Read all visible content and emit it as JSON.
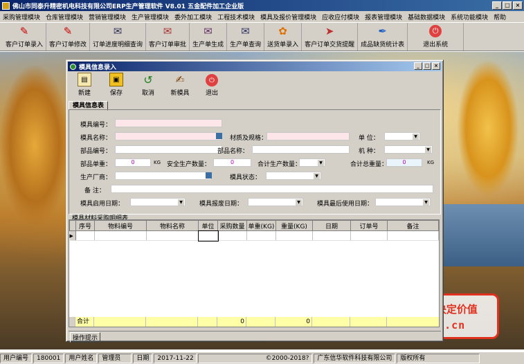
{
  "main_title": "佛山市同泰升精密机电科技有限公司ERP生产管理软件    V8.01  五金配件加工企业版",
  "menu": [
    "采购管理模块",
    "仓库管理模块",
    "营销管理模块",
    "生产管理模块",
    "委外加工模块",
    "工程技术模块",
    "模具及报价管理模块",
    "应收应付模块",
    "报表管理模块",
    "基础数据模块",
    "系统功能模块",
    "帮助"
  ],
  "toolbar": {
    "items": [
      {
        "label": "客户订单录入",
        "icon": "pdf-icon"
      },
      {
        "label": "客户订单修改",
        "icon": "pdf-icon"
      },
      {
        "label": "订单进度明细查询",
        "icon": "document-icon"
      },
      {
        "label": "客户订单审批",
        "icon": "document-icon"
      },
      {
        "label": "生产单生成",
        "icon": "document-icon"
      },
      {
        "label": "生产单查询",
        "icon": "document-icon"
      },
      {
        "label": "送货单录入",
        "icon": "flower-icon"
      },
      {
        "label": "客户订单交货提醒",
        "icon": "arrow-icon"
      },
      {
        "label": "成品缺货统计表",
        "icon": "feather-icon"
      },
      {
        "label": "退出系统",
        "icon": "exit-icon"
      }
    ]
  },
  "child_window": {
    "title": "模具信息录入",
    "toolbar": [
      {
        "label": "新建",
        "icon": "new-doc-icon"
      },
      {
        "label": "保存",
        "icon": "save-icon"
      },
      {
        "label": "取消",
        "icon": "cancel-icon"
      },
      {
        "label": "新模具",
        "icon": "pen-icon"
      },
      {
        "label": "退出",
        "icon": "exit-icon"
      }
    ],
    "tab": "模具信息表",
    "form": {
      "mold_code": "模具编号：",
      "mold_name": "模具名称：",
      "material_spec": "材质及规格：",
      "unit": "单  位：",
      "part_code": "部品编号：",
      "part_name": "部品名称：",
      "machine_type": "机  种：",
      "part_weight": "部品单重：",
      "part_weight_value": "0",
      "part_weight_unit": "KG",
      "safe_qty": "安全生产数量：",
      "safe_qty_value": "0",
      "total_qty": "合计生产数量：",
      "total_weight": "合计总重量：",
      "total_weight_value": "0",
      "total_weight_unit": "KG",
      "maker": "生产厂商：",
      "mold_status": "模具状态：",
      "remark": "备  注：",
      "start_date": "模具启用日期：",
      "scrap_date": "模具报废日期：",
      "last_use_date": "模具最后使用日期："
    },
    "grid": {
      "title": "模具材料采购明细表",
      "headers": [
        "序号",
        "物料编号",
        "物料名称",
        "单位",
        "采购数量",
        "单重(KG)",
        "重量(KG)",
        "日期",
        "订单号",
        "备注"
      ],
      "total_label": "合计",
      "total_qty": "0",
      "total_weight": "0"
    },
    "op_tip": "操作提示"
  },
  "ad": {
    "line1": "信华软件·品质决定价值",
    "line2": "www.xinwa.cn"
  },
  "status": {
    "user_code_label": "用户编号",
    "user_code": "180001",
    "user_name_label": "用户姓名",
    "user_name": "管理员",
    "date_label": "日期",
    "date": "2017-11-22",
    "copyright": "©2000-2018?",
    "company": "广东信华软件科技有限公司",
    "rights": "版权所有"
  }
}
